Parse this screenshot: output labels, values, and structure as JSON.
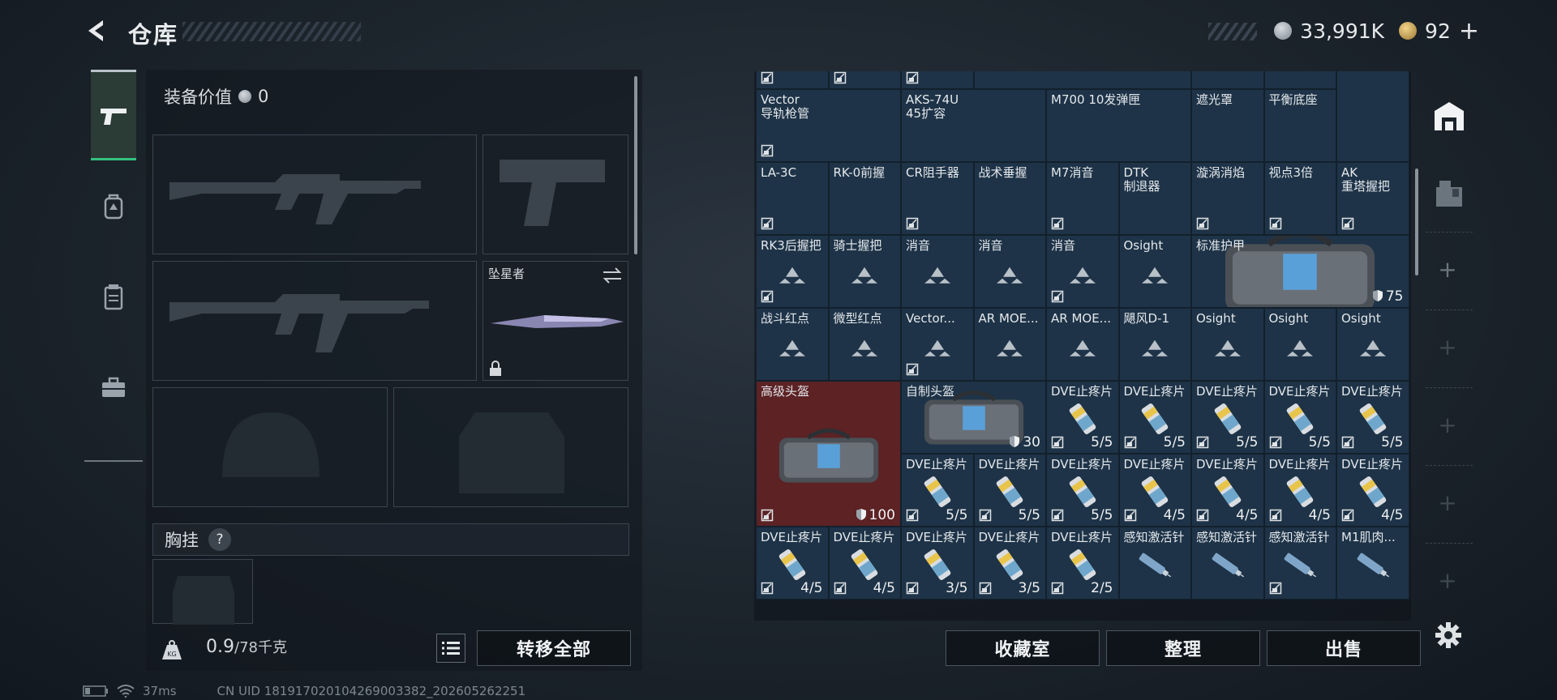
{
  "header": {
    "title": "仓库",
    "coins_value": "33,991K",
    "tickets_value": "92",
    "add_symbol": "+"
  },
  "sidebar": {
    "items": [
      {
        "icon": "pistol-icon",
        "active": true
      },
      {
        "icon": "backpack-icon",
        "active": false
      },
      {
        "icon": "vest-icon",
        "active": false
      },
      {
        "icon": "toolbox-icon",
        "active": false
      }
    ]
  },
  "equipment": {
    "value_label": "装备价值",
    "value": "0",
    "melee_name": "坠星者",
    "chest_label": "胸挂",
    "chest_help": "?",
    "weight_current": "0.9",
    "weight_max": "/78千克",
    "transfer_all": "转移全部"
  },
  "inventory": {
    "bottom_buttons": [
      "收藏室",
      "整理",
      "出售"
    ],
    "cells": [
      {
        "label": "",
        "row": 0,
        "col": 0,
        "w": 1,
        "h": 1,
        "locked": true
      },
      {
        "label": "",
        "row": 0,
        "col": 1,
        "w": 1,
        "h": 1,
        "locked": true
      },
      {
        "label": "",
        "row": 0,
        "col": 2,
        "w": 1,
        "h": 1,
        "locked": true
      },
      {
        "label": "",
        "row": 0,
        "col": 3,
        "w": 3,
        "h": 1,
        "locked": false
      },
      {
        "label": "",
        "row": 0,
        "col": 6,
        "w": 1,
        "h": 1,
        "locked": false
      },
      {
        "label": "",
        "row": 0,
        "col": 7,
        "w": 1,
        "h": 1,
        "locked": false
      },
      {
        "label": "",
        "row": 0,
        "col": 8,
        "w": 1,
        "h": 2,
        "locked": false
      },
      {
        "label": "Vector\n导轨枪管",
        "row": 1,
        "col": 0,
        "w": 2,
        "h": 1,
        "locked": true
      },
      {
        "label": "AKS-74U\n45扩容",
        "row": 1,
        "col": 2,
        "w": 2,
        "h": 1,
        "locked": false
      },
      {
        "label": "M700 10发弹匣",
        "row": 1,
        "col": 4,
        "w": 2,
        "h": 1,
        "locked": false
      },
      {
        "label": "遮光罩",
        "row": 1,
        "col": 6,
        "w": 1,
        "h": 1,
        "locked": false
      },
      {
        "label": "平衡底座",
        "row": 1,
        "col": 7,
        "w": 1,
        "h": 1,
        "locked": false
      },
      {
        "label": "LA-3C",
        "row": 2,
        "col": 0,
        "w": 1,
        "h": 1,
        "locked": true
      },
      {
        "label": "RK-0前握",
        "row": 2,
        "col": 1,
        "w": 1,
        "h": 1,
        "locked": false
      },
      {
        "label": "CR阻手器",
        "row": 2,
        "col": 2,
        "w": 1,
        "h": 1,
        "locked": true
      },
      {
        "label": "战术垂握",
        "row": 2,
        "col": 3,
        "w": 1,
        "h": 1,
        "locked": false
      },
      {
        "label": "M7消音",
        "row": 2,
        "col": 4,
        "w": 1,
        "h": 1,
        "locked": true
      },
      {
        "label": "DTK\n制退器",
        "row": 2,
        "col": 5,
        "w": 1,
        "h": 1,
        "locked": false
      },
      {
        "label": "漩涡消焰",
        "row": 2,
        "col": 6,
        "w": 1,
        "h": 1,
        "locked": true
      },
      {
        "label": "视点3倍",
        "row": 2,
        "col": 7,
        "w": 1,
        "h": 1,
        "locked": true
      },
      {
        "label": "AK\n重塔握把",
        "row": 2,
        "col": 8,
        "w": 1,
        "h": 1,
        "locked": true
      },
      {
        "label": "RK3后握把",
        "row": 3,
        "col": 0,
        "w": 1,
        "h": 1,
        "locked": true,
        "tri": true
      },
      {
        "label": "骑士握把",
        "row": 3,
        "col": 1,
        "w": 1,
        "h": 1,
        "locked": false,
        "tri": true
      },
      {
        "label": "消音",
        "row": 3,
        "col": 2,
        "w": 1,
        "h": 1,
        "locked": false,
        "tri": true
      },
      {
        "label": "消音",
        "row": 3,
        "col": 3,
        "w": 1,
        "h": 1,
        "locked": false,
        "tri": true
      },
      {
        "label": "消音",
        "row": 3,
        "col": 4,
        "w": 1,
        "h": 1,
        "locked": true,
        "tri": true
      },
      {
        "label": "Osight",
        "row": 3,
        "col": 5,
        "w": 1,
        "h": 1,
        "locked": false,
        "tri": true
      },
      {
        "label": "标准护甲",
        "row": 3,
        "col": 6,
        "w": 3,
        "h": 1,
        "locked": false,
        "count": "75",
        "shield": true,
        "bag": true
      },
      {
        "label": "战斗红点",
        "row": 4,
        "col": 0,
        "w": 1,
        "h": 1,
        "locked": false,
        "tri": true
      },
      {
        "label": "微型红点",
        "row": 4,
        "col": 1,
        "w": 1,
        "h": 1,
        "locked": false,
        "tri": true
      },
      {
        "label": "Vector...",
        "row": 4,
        "col": 2,
        "w": 1,
        "h": 1,
        "locked": true,
        "tri": true
      },
      {
        "label": "AR MOE...",
        "row": 4,
        "col": 3,
        "w": 1,
        "h": 1,
        "locked": false,
        "tri": true
      },
      {
        "label": "AR MOE...",
        "row": 4,
        "col": 4,
        "w": 1,
        "h": 1,
        "locked": false,
        "tri": true
      },
      {
        "label": "飓风D-1",
        "row": 4,
        "col": 5,
        "w": 1,
        "h": 1,
        "locked": false,
        "tri": true
      },
      {
        "label": "Osight",
        "row": 4,
        "col": 6,
        "w": 1,
        "h": 1,
        "locked": false,
        "tri": true
      },
      {
        "label": "Osight",
        "row": 4,
        "col": 7,
        "w": 1,
        "h": 1,
        "locked": false,
        "tri": true
      },
      {
        "label": "Osight",
        "row": 4,
        "col": 8,
        "w": 1,
        "h": 1,
        "locked": false,
        "tri": true
      },
      {
        "label": "高级头盔",
        "row": 5,
        "col": 0,
        "w": 2,
        "h": 2,
        "locked": true,
        "count": "100",
        "shield": true,
        "red": true,
        "bag": true
      },
      {
        "label": "自制头盔",
        "row": 5,
        "col": 2,
        "w": 2,
        "h": 1,
        "locked": false,
        "count": "30",
        "shield": true,
        "bag": true
      },
      {
        "label": "DVE止疼片",
        "row": 5,
        "col": 4,
        "w": 1,
        "h": 1,
        "locked": true,
        "count": "5/5",
        "med": true
      },
      {
        "label": "DVE止疼片",
        "row": 5,
        "col": 5,
        "w": 1,
        "h": 1,
        "locked": true,
        "count": "5/5",
        "med": true
      },
      {
        "label": "DVE止疼片",
        "row": 5,
        "col": 6,
        "w": 1,
        "h": 1,
        "locked": true,
        "count": "5/5",
        "med": true
      },
      {
        "label": "DVE止疼片",
        "row": 5,
        "col": 7,
        "w": 1,
        "h": 1,
        "locked": true,
        "count": "5/5",
        "med": true
      },
      {
        "label": "DVE止疼片",
        "row": 5,
        "col": 8,
        "w": 1,
        "h": 1,
        "locked": true,
        "count": "5/5",
        "med": true
      },
      {
        "label": "DVE止疼片",
        "row": 6,
        "col": 2,
        "w": 1,
        "h": 1,
        "locked": true,
        "count": "5/5",
        "med": true
      },
      {
        "label": "DVE止疼片",
        "row": 6,
        "col": 3,
        "w": 1,
        "h": 1,
        "locked": true,
        "count": "5/5",
        "med": true
      },
      {
        "label": "DVE止疼片",
        "row": 6,
        "col": 4,
        "w": 1,
        "h": 1,
        "locked": true,
        "count": "5/5",
        "med": true
      },
      {
        "label": "DVE止疼片",
        "row": 6,
        "col": 5,
        "w": 1,
        "h": 1,
        "locked": true,
        "count": "4/5",
        "med": true
      },
      {
        "label": "DVE止疼片",
        "row": 6,
        "col": 6,
        "w": 1,
        "h": 1,
        "locked": true,
        "count": "4/5",
        "med": true
      },
      {
        "label": "DVE止疼片",
        "row": 6,
        "col": 7,
        "w": 1,
        "h": 1,
        "locked": true,
        "count": "4/5",
        "med": true
      },
      {
        "label": "DVE止疼片",
        "row": 6,
        "col": 8,
        "w": 1,
        "h": 1,
        "locked": true,
        "count": "4/5",
        "med": true
      },
      {
        "label": "DVE止疼片",
        "row": 7,
        "col": 0,
        "w": 1,
        "h": 1,
        "locked": true,
        "count": "4/5",
        "med": true
      },
      {
        "label": "DVE止疼片",
        "row": 7,
        "col": 1,
        "w": 1,
        "h": 1,
        "locked": true,
        "count": "4/5",
        "med": true
      },
      {
        "label": "DVE止疼片",
        "row": 7,
        "col": 2,
        "w": 1,
        "h": 1,
        "locked": true,
        "count": "3/5",
        "med": true
      },
      {
        "label": "DVE止疼片",
        "row": 7,
        "col": 3,
        "w": 1,
        "h": 1,
        "locked": true,
        "count": "3/5",
        "med": true
      },
      {
        "label": "DVE止疼片",
        "row": 7,
        "col": 4,
        "w": 1,
        "h": 1,
        "locked": true,
        "count": "2/5",
        "med": true
      },
      {
        "label": "感知激活针",
        "row": 7,
        "col": 5,
        "w": 1,
        "h": 1,
        "locked": false,
        "syringe": true
      },
      {
        "label": "感知激活针",
        "row": 7,
        "col": 6,
        "w": 1,
        "h": 1,
        "locked": false,
        "syringe": true
      },
      {
        "label": "感知激活针",
        "row": 7,
        "col": 7,
        "w": 1,
        "h": 1,
        "locked": true,
        "syringe": true
      },
      {
        "label": "M1肌肉...",
        "row": 7,
        "col": 8,
        "w": 1,
        "h": 1,
        "locked": false,
        "syringe": true
      }
    ]
  },
  "status": {
    "ping": "37ms",
    "uid": "CN UID 18191702010426900338​2_202605262251"
  }
}
